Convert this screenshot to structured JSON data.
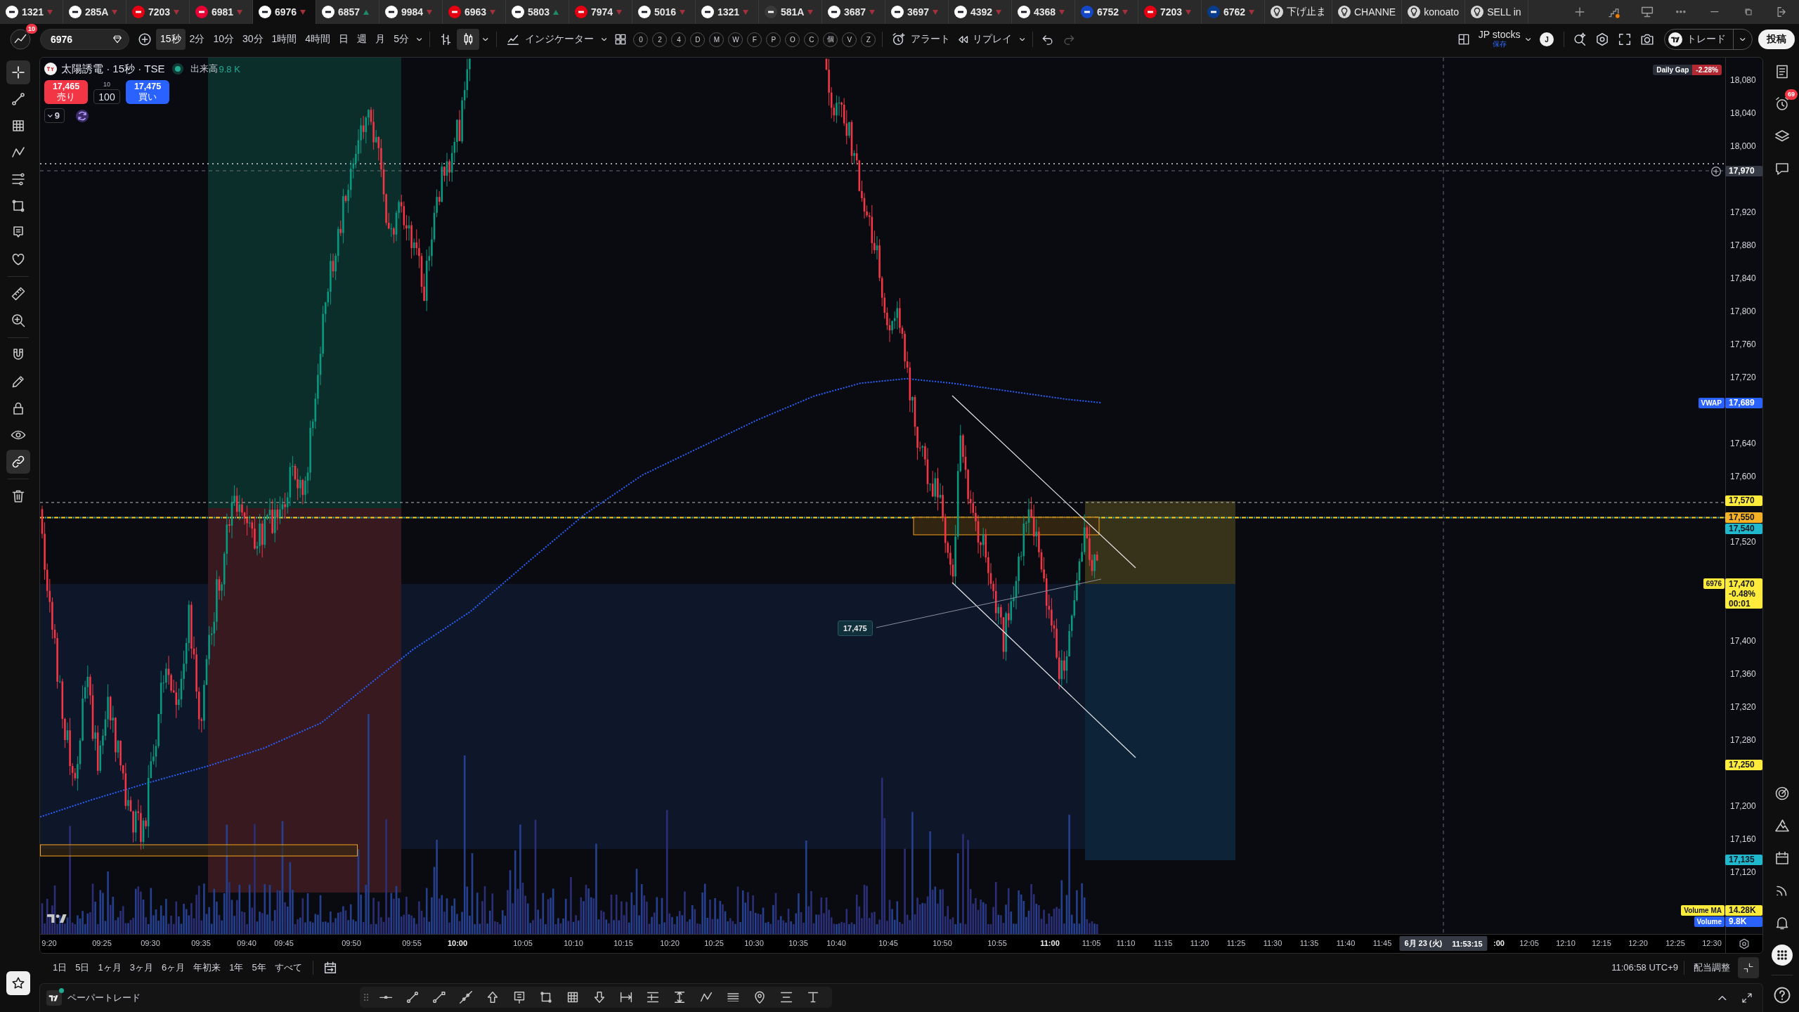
{
  "tabs": [
    {
      "kind": "symbol",
      "label": "1321",
      "color": "#ffffff",
      "rising": false,
      "selected": false
    },
    {
      "kind": "symbol",
      "label": "285A",
      "color": "#ffffff",
      "rising": false,
      "selected": false
    },
    {
      "kind": "symbol",
      "label": "7203",
      "color": "#e60012",
      "rising": false,
      "selected": false
    },
    {
      "kind": "symbol",
      "label": "6981",
      "color": "#e60033",
      "rising": false,
      "selected": false
    },
    {
      "kind": "symbol",
      "label": "6976",
      "color": "#ffffff",
      "rising": false,
      "selected": true
    },
    {
      "kind": "symbol",
      "label": "6857",
      "color": "#ffffff",
      "rising": true,
      "selected": false
    },
    {
      "kind": "symbol",
      "label": "9984",
      "color": "#ffffff",
      "rising": false,
      "selected": false
    },
    {
      "kind": "symbol",
      "label": "6963",
      "color": "#e60012",
      "rising": false,
      "selected": false
    },
    {
      "kind": "symbol",
      "label": "5803",
      "color": "#ffffff",
      "rising": true,
      "selected": false
    },
    {
      "kind": "symbol",
      "label": "7974",
      "color": "#e60012",
      "rising": false,
      "selected": false
    },
    {
      "kind": "symbol",
      "label": "5016",
      "color": "#ffffff",
      "rising": false,
      "selected": false
    },
    {
      "kind": "symbol",
      "label": "1321",
      "color": "#ffffff",
      "rising": false,
      "selected": false
    },
    {
      "kind": "symbol",
      "label": "581A",
      "color": "#3a3a3a",
      "rising": false,
      "selected": false
    },
    {
      "kind": "symbol",
      "label": "3687",
      "color": "#ffffff",
      "rising": false,
      "selected": false
    },
    {
      "kind": "symbol",
      "label": "3697",
      "color": "#ffffff",
      "rising": false,
      "selected": false
    },
    {
      "kind": "symbol",
      "label": "4392",
      "color": "#ffffff",
      "rising": false,
      "selected": false
    },
    {
      "kind": "symbol",
      "label": "4368",
      "color": "#ffffff",
      "rising": false,
      "selected": false
    },
    {
      "kind": "symbol",
      "label": "6752",
      "color": "#1448c8",
      "rising": false,
      "selected": false
    },
    {
      "kind": "symbol",
      "label": "7203",
      "color": "#e60012",
      "rising": false,
      "selected": false
    },
    {
      "kind": "symbol",
      "label": "6762",
      "color": "#0a3c8c",
      "rising": false,
      "selected": false
    },
    {
      "kind": "idea",
      "label": "下げ止ま",
      "selected": false
    },
    {
      "kind": "idea",
      "label": "CHANNE",
      "selected": false
    },
    {
      "kind": "idea",
      "label": "konoato",
      "selected": false
    },
    {
      "kind": "idea",
      "label": "SELL in",
      "selected": false
    }
  ],
  "toolbar": {
    "notification_count": "10",
    "symbol": "6976",
    "intervals": [
      {
        "label": "15秒",
        "selected": true
      },
      {
        "label": "2分",
        "selected": false
      },
      {
        "label": "10分",
        "selected": false
      },
      {
        "label": "30分",
        "selected": false
      },
      {
        "label": "1時間",
        "selected": false
      },
      {
        "label": "4時間",
        "selected": false
      },
      {
        "label": "日",
        "selected": false
      },
      {
        "label": "週",
        "selected": false
      },
      {
        "label": "月",
        "selected": false
      },
      {
        "label": "5分",
        "selected": false
      }
    ],
    "chart_types": [
      {
        "selected": false
      },
      {
        "selected": true
      }
    ],
    "indicators": "インジケーター",
    "shortcuts": [
      "0",
      "2",
      "4",
      "D",
      "M",
      "W",
      "F",
      "P",
      "O",
      "C",
      "個",
      "V",
      "Z"
    ],
    "alert": "アラート",
    "replay": "リプレイ",
    "redo_disabled": true,
    "layout_name": "JP stocks",
    "layout_status": "保存",
    "user_initial": "J",
    "trade": "トレード",
    "publish": "投稿"
  },
  "left_tools": [
    [
      {
        "active": true
      },
      {
        "active": false
      },
      {
        "active": false
      },
      {
        "active": false
      },
      {
        "active": false
      },
      {
        "active": false
      },
      {
        "active": false
      },
      {
        "active": false
      }
    ],
    [
      {
        "active": false
      },
      {
        "active": false
      }
    ],
    [
      {
        "active": false
      },
      {
        "active": false
      },
      {
        "active": false
      },
      {
        "active": false
      },
      {
        "active": true
      }
    ],
    [
      {
        "active": false
      }
    ]
  ],
  "legend": {
    "title": "太陽誘電 · 15秒 · TSE",
    "market_open": true,
    "volume_label": "出来高",
    "volume_value": "9.8 K",
    "sell": {
      "price": "17,465",
      "label": "売り"
    },
    "quantity_step": "10",
    "quantity": "100",
    "buy": {
      "price": "17,475",
      "label": "買い"
    },
    "collapsed_count": "9"
  },
  "daily_gap": {
    "label": "Daily Gap",
    "value": "-2.28%"
  },
  "price_axis": {
    "ticks": [
      "18,080",
      "18,040",
      "18,000",
      "17,920",
      "17,880",
      "17,840",
      "17,800",
      "17,760",
      "17,720",
      "17,640",
      "17,600",
      "17,520",
      "17,400",
      "17,360",
      "17,320",
      "17,280",
      "17,200",
      "17,160",
      "17,120"
    ],
    "markers": [
      {
        "kind": "crosshair",
        "price": "17,970",
        "color": "#363a45"
      },
      {
        "kind": "indicator",
        "name": "VWAP",
        "price": "17,689",
        "color": "#2962ff"
      },
      {
        "kind": "line",
        "price": "17,570",
        "color": "#ffeb3b"
      },
      {
        "kind": "line",
        "price": "17,550",
        "color": "#f7b125"
      },
      {
        "kind": "line",
        "price": "17,540",
        "color": "#1fb8cd"
      },
      {
        "kind": "last",
        "name": "6976",
        "price": "17,470",
        "change": "-0.48%",
        "countdown": "00:01",
        "color": "#ffeb3b"
      },
      {
        "kind": "line",
        "price": "17,250",
        "color": "#ffeb3b"
      },
      {
        "kind": "line",
        "price": "17,135",
        "color": "#1fb8cd"
      },
      {
        "kind": "volume",
        "name": "Volume MA",
        "value": "14.28K",
        "color": "#ffeb3b"
      },
      {
        "kind": "volume",
        "name": "Volume",
        "value": "9.8K",
        "color": "#2962ff"
      }
    ]
  },
  "drawing_label": "17,475",
  "time_axis": {
    "ticks": [
      {
        "label": "9:20",
        "major": false
      },
      {
        "label": "09:25",
        "major": false
      },
      {
        "label": "09:30",
        "major": false
      },
      {
        "label": "09:35",
        "major": false
      },
      {
        "label": "09:40",
        "major": false
      },
      {
        "label": "09:45",
        "major": false
      },
      {
        "label": "09:50",
        "major": false
      },
      {
        "label": "09:55",
        "major": false
      },
      {
        "label": "10:00",
        "major": true
      },
      {
        "label": "10:05",
        "major": false
      },
      {
        "label": "10:10",
        "major": false
      },
      {
        "label": "10:15",
        "major": false
      },
      {
        "label": "10:20",
        "major": false
      },
      {
        "label": "10:25",
        "major": false
      },
      {
        "label": "10:30",
        "major": false
      },
      {
        "label": "10:35",
        "major": false
      },
      {
        "label": "10:40",
        "major": false
      },
      {
        "label": "10:45",
        "major": false
      },
      {
        "label": "10:50",
        "major": false
      },
      {
        "label": "10:55",
        "major": false
      },
      {
        "label": "11:00",
        "major": true
      },
      {
        "label": "11:05",
        "major": false
      },
      {
        "label": "11:10",
        "major": false
      },
      {
        "label": "11:15",
        "major": false
      },
      {
        "label": "11:20",
        "major": false
      },
      {
        "label": "11:25",
        "major": false
      },
      {
        "label": "11:30",
        "major": false
      },
      {
        "label": "11:35",
        "major": false
      },
      {
        "label": "11:40",
        "major": false
      },
      {
        "label": "11:45",
        "major": false
      },
      {
        "label": ":00",
        "major": true
      },
      {
        "label": "12:05",
        "major": false
      },
      {
        "label": "12:10",
        "major": false
      },
      {
        "label": "12:15",
        "major": false
      },
      {
        "label": "12:20",
        "major": false
      },
      {
        "label": "12:25",
        "major": false
      },
      {
        "label": "12:30",
        "major": false
      }
    ],
    "crosshair_date": "6月 23 (火)",
    "crosshair_time": "11:53:15"
  },
  "ranges": [
    "1日",
    "5日",
    "1ヶ月",
    "3ヶ月",
    "6ヶ月",
    "年初来",
    "1年",
    "5年",
    "すべて"
  ],
  "status": {
    "clock": "11:06:58 UTC+9",
    "adjustment": "配当調整"
  },
  "bottom_panel": {
    "title": "ペーパートレード",
    "connected": true
  },
  "sidebar": {
    "alerts_badge": "69"
  }
}
